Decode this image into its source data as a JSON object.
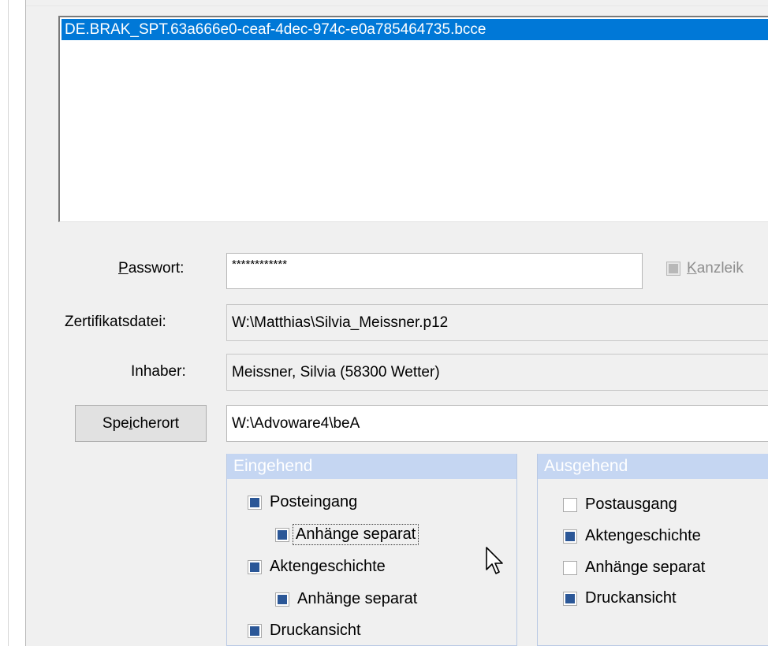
{
  "list": {
    "items": [
      "DE.BRAK_SPT.63a666e0-ceaf-4dec-974c-e0a785464735.bcce"
    ],
    "selected_index": 0
  },
  "password": {
    "label_prefix": "",
    "label_hotkey": "P",
    "label_rest": "asswort:",
    "value": "************"
  },
  "kanzlei": {
    "hotkey": "K",
    "label_rest": "anzleik",
    "checked": true,
    "enabled": false
  },
  "zertifikat": {
    "label": "Zertifikatsdatei:",
    "value": "W:\\Matthias\\Silvia_Meissner.p12"
  },
  "inhaber": {
    "label": "Inhaber:",
    "value": "Meissner, Silvia (58300 Wetter)"
  },
  "speicherort": {
    "label_prefix": "Spe",
    "label_hotkey": "i",
    "label_rest": "cherort",
    "value": "W:\\Advoware4\\beA"
  },
  "eingehend": {
    "title": "Eingehend",
    "options": [
      {
        "label": "Posteingang",
        "checked": true
      },
      {
        "label": "Anhänge separat",
        "checked": true
      },
      {
        "label": "Aktengeschichte",
        "checked": true
      },
      {
        "label": "Anhänge separat",
        "checked": true
      },
      {
        "label": "Druckansicht",
        "checked": true
      }
    ]
  },
  "ausgehend": {
    "title": "Ausgehend",
    "options": [
      {
        "label": "Postausgang",
        "checked": false
      },
      {
        "label": "Aktengeschichte",
        "checked": true
      },
      {
        "label": "Anhänge separat",
        "checked": false
      },
      {
        "label": "Druckansicht",
        "checked": true
      }
    ]
  },
  "colors": {
    "selection": "#0078d7",
    "group_header": "#c5d6f2",
    "checkbox_fill": "#2b5797"
  }
}
